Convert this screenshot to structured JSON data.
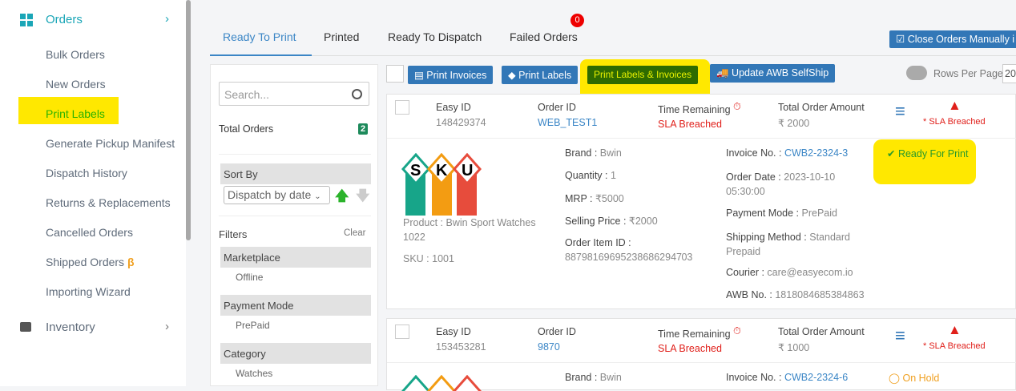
{
  "sidebar": {
    "orders": "Orders",
    "items": [
      "Bulk Orders",
      "New Orders",
      "Print Labels",
      "Generate Pickup Manifest",
      "Dispatch History",
      "Returns & Replacements",
      "Cancelled Orders",
      "Shipped Orders",
      "Importing Wizard"
    ],
    "beta": "β",
    "inventory": "Inventory"
  },
  "tabs": [
    "Ready To Print",
    "Printed",
    "Ready To Dispatch",
    "Failed Orders"
  ],
  "failed_badge": "0",
  "close_manually": "Close Orders Manually i",
  "filters": {
    "search_placeholder": "Search...",
    "total_label": "Total Orders",
    "total": "2",
    "sort_by": "Sort By",
    "sort_value": "Dispatch by date",
    "filters": "Filters",
    "clear": "Clear",
    "marketplace": "Marketplace",
    "marketplace_val": "Offline",
    "payment": "Payment Mode",
    "payment_val": "PrePaid",
    "category": "Category",
    "category_val": "Watches"
  },
  "toolbar": {
    "print_invoices": "Print Invoices",
    "print_labels": "Print Labels",
    "print_both": "Print Labels & Invoices",
    "update_awb": "Update AWB SelfShip",
    "rows_per_page": "Rows Per Page",
    "rows_value": "20"
  },
  "labels": {
    "easy_id": "Easy ID",
    "order_id": "Order ID",
    "time_remaining": "Time Remaining",
    "total_amount": "Total Order Amount",
    "sla_breached": "SLA Breached",
    "sla_note": "* SLA Breached",
    "brand": "Brand : ",
    "quantity": "Quantity : ",
    "mrp": "MRP : ",
    "selling": "Selling Price : ",
    "item_id": "Order Item ID :",
    "invoice": "Invoice No. : ",
    "order_date": "Order Date : ",
    "payment": "Payment Mode : ",
    "shipping": "Shipping Method : ",
    "courier": "Courier : ",
    "awb": "AWB No. : ",
    "product": "Product : ",
    "sku": "SKU : "
  },
  "orders": [
    {
      "easy_id": "148429374",
      "order_id": "WEB_TEST1",
      "amount": "₹ 2000",
      "brand": "Bwin",
      "quantity": "1",
      "mrp": "₹5000",
      "selling": "₹2000",
      "item_id": "887981696952386862947 03",
      "invoice": "CWB2-2324-3",
      "order_date": "2023-10-10",
      "order_time": "05:30:00",
      "payment": "PrePaid",
      "shipping": "Standard",
      "shipping2": "Prepaid",
      "courier": "care@easyecom.io",
      "awb": "1818084685384863",
      "product": "Bwin Sport Watches",
      "product2": "1022",
      "sku": "1001",
      "status": "Ready For Print"
    },
    {
      "easy_id": "153453281",
      "order_id": "9870",
      "amount": "₹ 1000",
      "brand": "Bwin",
      "invoice": "CWB2-2324-6",
      "status": "On Hold"
    }
  ],
  "sku_logo": "SKU",
  "colors": {
    "accent": "#3277b7",
    "green_btn": "#2f6b00",
    "highlight": "#ffe800",
    "red": "#e0201b",
    "teal": "#1aa6b7"
  }
}
